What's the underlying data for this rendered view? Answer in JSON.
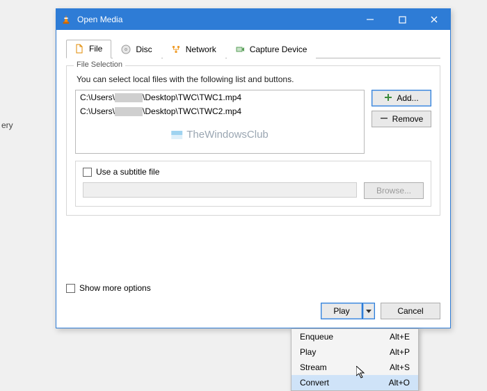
{
  "bg_label": "ery",
  "window": {
    "title": "Open Media",
    "tabs": [
      {
        "label": "File",
        "icon": "file"
      },
      {
        "label": "Disc",
        "icon": "disc"
      },
      {
        "label": "Network",
        "icon": "network"
      },
      {
        "label": "Capture Device",
        "icon": "capture"
      }
    ]
  },
  "file_selection": {
    "legend": "File Selection",
    "hint": "You can select local files with the following list and buttons.",
    "items": [
      {
        "prefix": "C:\\Users\\",
        "suffix": "\\Desktop\\TWC\\TWC1.mp4"
      },
      {
        "prefix": "C:\\Users\\",
        "suffix": "\\Desktop\\TWC\\TWC2.mp4"
      }
    ],
    "add_label": "Add...",
    "remove_label": "Remove",
    "watermark": "TheWindowsClub"
  },
  "subtitle": {
    "checkbox_label": "Use a subtitle file",
    "browse_label": "Browse..."
  },
  "bottom": {
    "more_label": "Show more options",
    "play_label": "Play",
    "cancel_label": "Cancel"
  },
  "menu": [
    {
      "label": "Enqueue",
      "shortcut": "Alt+E"
    },
    {
      "label": "Play",
      "shortcut": "Alt+P"
    },
    {
      "label": "Stream",
      "shortcut": "Alt+S"
    },
    {
      "label": "Convert",
      "shortcut": "Alt+O"
    }
  ]
}
